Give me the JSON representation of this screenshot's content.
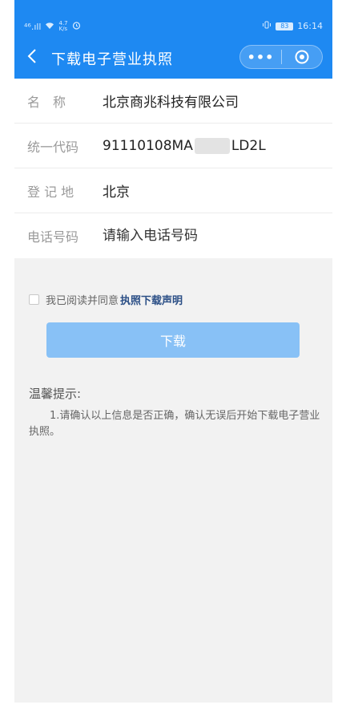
{
  "status_bar": {
    "signal": "⁴⁶.ıll",
    "speed_value": "4.7",
    "speed_unit": "K/s",
    "battery": "83",
    "time": "16:14"
  },
  "nav": {
    "title": "下载电子营业执照",
    "more": "•••"
  },
  "form": {
    "name_label": "名　称",
    "name_value": "北京商兆科技有限公司",
    "code_label": "统一代码",
    "code_prefix": "91110108MA",
    "code_suffix": "LD2L",
    "location_label": "登 记 地",
    "location_value": "北京",
    "phone_label": "电话号码",
    "phone_placeholder": "请输入电话号码"
  },
  "agreement": {
    "text": "我已阅读并同意",
    "link": "执照下载声明"
  },
  "download_button": "下载",
  "tips": {
    "title": "温馨提示:",
    "content": "1.请确认以上信息是否正确，确认无误后开始下载电子营业执照。"
  },
  "colors": {
    "primary": "#1e89f2",
    "button_disabled": "#88c1f6",
    "link": "#2b4f86"
  }
}
